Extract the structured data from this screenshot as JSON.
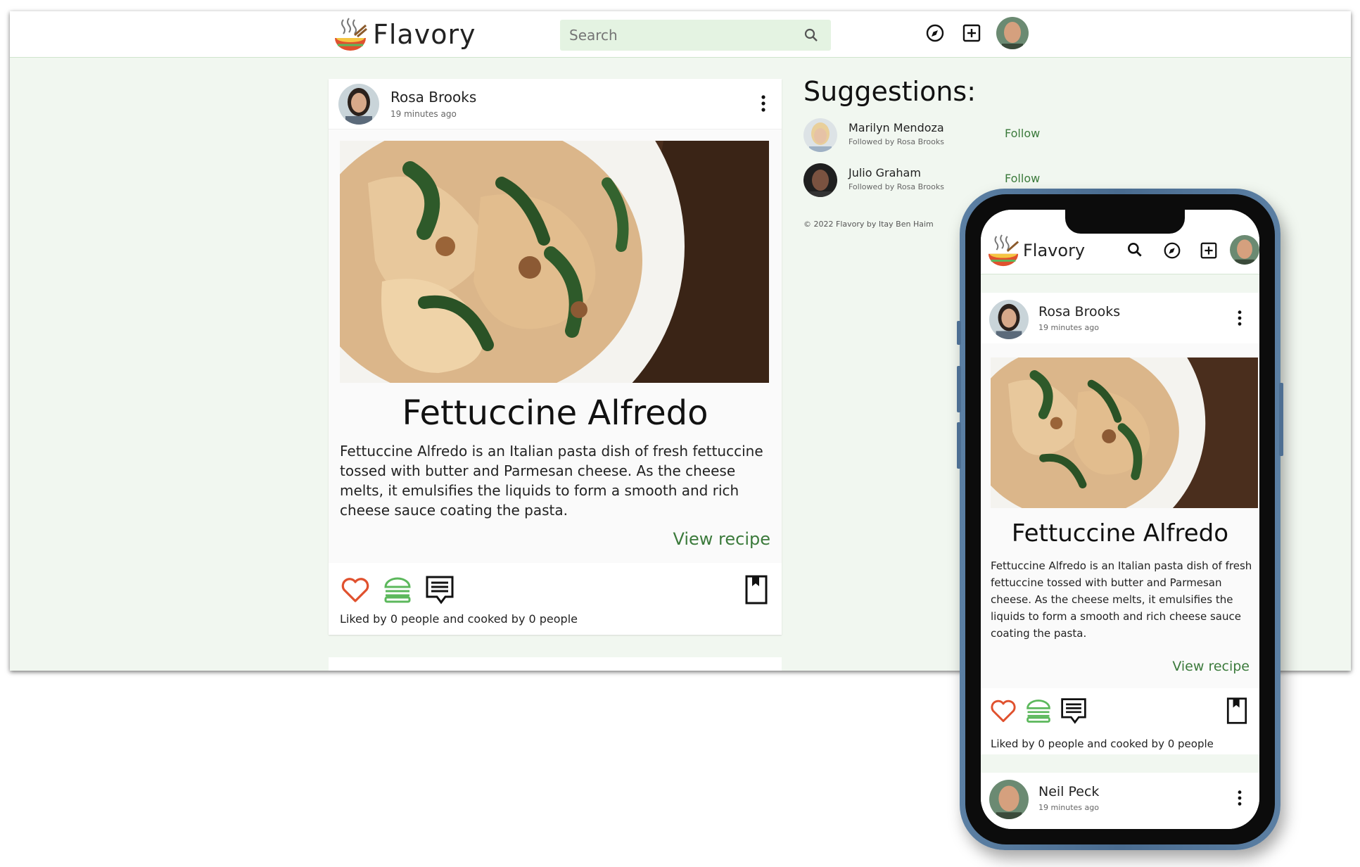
{
  "app": {
    "brand": "Flavory"
  },
  "search": {
    "placeholder": "Search"
  },
  "post": {
    "author": "Rosa Brooks",
    "time": "19 minutes ago",
    "title": "Fettuccine Alfredo",
    "description": "Fettuccine Alfredo is an Italian pasta dish of fresh fettuccine tossed with butter and Parmesan cheese. As the cheese melts, it emulsifies the liquids to form a smooth and rich cheese sauce coating the pasta.",
    "view_label": "View recipe",
    "stats": "Liked by 0 people and cooked by 0 people"
  },
  "suggestions": {
    "title": "Suggestions:",
    "items": [
      {
        "name": "Marilyn Mendoza",
        "sub": "Followed by Rosa Brooks",
        "action": "Follow"
      },
      {
        "name": "Julio Graham",
        "sub": "Followed by Rosa Brooks",
        "action": "Follow"
      }
    ],
    "copyright": "© 2022 Flavory by Itay Ben Haim"
  },
  "mobile": {
    "next_post": {
      "author": "Neil Peck",
      "time": "19 minutes ago"
    }
  },
  "colors": {
    "accent": "#3b7a3b",
    "heart": "#e0512e",
    "burger": "#5cb85c",
    "background": "#f1f7f0",
    "search_bg": "#e4f3e2"
  },
  "icons": [
    "search-icon",
    "compass-icon",
    "add-box-icon",
    "more-vert-icon",
    "heart-icon",
    "burger-icon",
    "comment-icon",
    "bookmark-icon"
  ]
}
